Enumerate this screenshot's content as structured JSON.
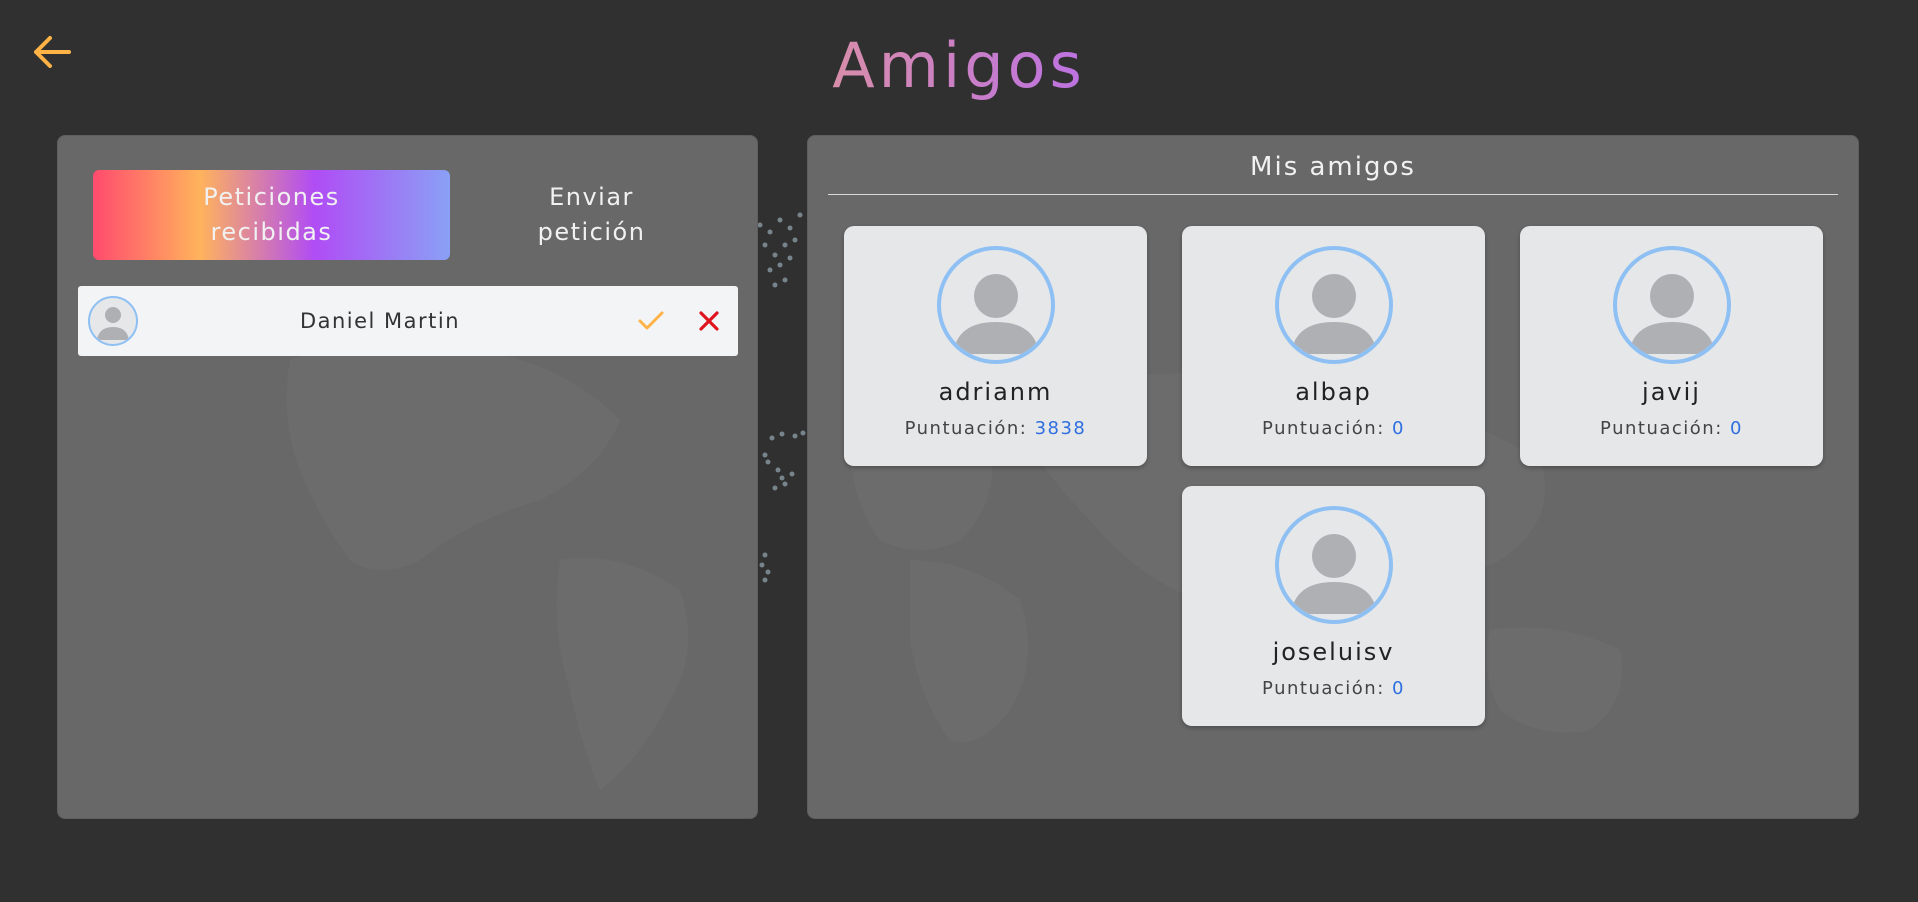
{
  "header": {
    "title": "Amigos",
    "back_icon": "arrow-left-icon"
  },
  "requests_panel": {
    "tabs": [
      {
        "label": "Peticiones\nrecibidas",
        "active": true
      },
      {
        "label": "Enviar\npetición",
        "active": false
      }
    ],
    "requests": [
      {
        "name": "Daniel Martin",
        "accept_icon": "check-icon",
        "reject_icon": "close-icon"
      }
    ]
  },
  "friends_panel": {
    "heading": "Mis amigos",
    "score_label": "Puntuación:",
    "friends": [
      {
        "username": "adrianm",
        "score": "3838"
      },
      {
        "username": "albap",
        "score": "0"
      },
      {
        "username": "javij",
        "score": "0"
      },
      {
        "username": "joseluisv",
        "score": "0"
      }
    ]
  },
  "colors": {
    "background": "#303030",
    "accent_orange": "#ffb347",
    "reject_red": "#e0141e",
    "avatar_border": "#8ec0f4",
    "score_blue": "#2f6fe0"
  }
}
